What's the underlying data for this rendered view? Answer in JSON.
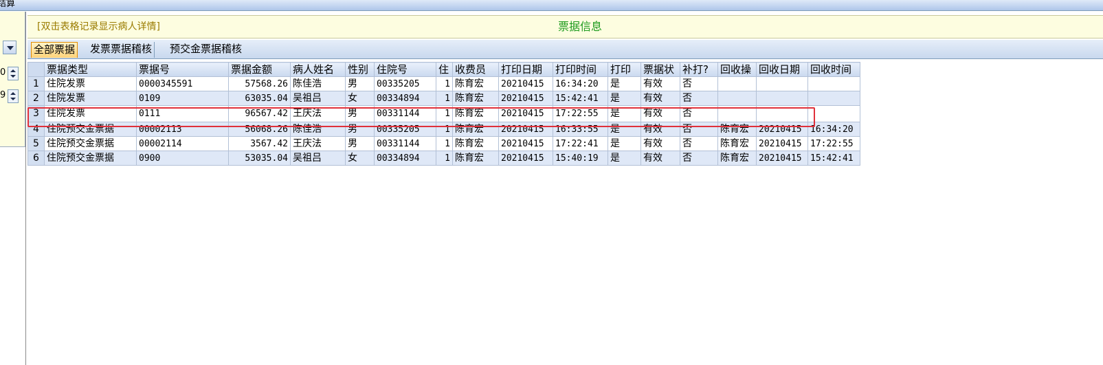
{
  "window": {
    "title_fragment": "结算"
  },
  "left_panel": {
    "spin1_value": "0",
    "spin2_value": "9"
  },
  "info_header": {
    "hint": "[双击表格记录显示病人详情]",
    "title": "票据信息"
  },
  "tabs": [
    {
      "label": "全部票据",
      "active": true
    },
    {
      "label": "发票票据稽核",
      "active": false
    },
    {
      "label": "预交金票据稽核",
      "active": false
    }
  ],
  "table": {
    "columns": [
      "票据类型",
      "票据号",
      "票据金额",
      "病人姓名",
      "性别",
      "住院号",
      "住",
      "收费员",
      "打印日期",
      "打印时间",
      "打印",
      "票据状",
      "补打?",
      "回收操",
      "回收日期",
      "回收时间"
    ],
    "rows": [
      [
        "1",
        "住院发票",
        "0000345591",
        "57568.26",
        "陈佳浩",
        "男",
        "00335205",
        "1",
        "陈育宏",
        "20210415",
        "16:34:20",
        "是",
        "有效",
        "否",
        "",
        "",
        ""
      ],
      [
        "2",
        "住院发票",
        "0109",
        "63035.04",
        "吴祖吕",
        "女",
        "00334894",
        "1",
        "陈育宏",
        "20210415",
        "15:42:41",
        "是",
        "有效",
        "否",
        "",
        "",
        ""
      ],
      [
        "3",
        "住院发票",
        "0111",
        "96567.42",
        "王庆法",
        "男",
        "00331144",
        "1",
        "陈育宏",
        "20210415",
        "17:22:55",
        "是",
        "有效",
        "否",
        "",
        "",
        ""
      ],
      [
        "4",
        "住院预交金票据",
        "00002113",
        "56068.26",
        "陈佳浩",
        "男",
        "00335205",
        "1",
        "陈育宏",
        "20210415",
        "16:33:55",
        "是",
        "有效",
        "否",
        "陈育宏",
        "20210415",
        "16:34:20"
      ],
      [
        "5",
        "住院预交金票据",
        "00002114",
        "3567.42",
        "王庆法",
        "男",
        "00331144",
        "1",
        "陈育宏",
        "20210415",
        "17:22:41",
        "是",
        "有效",
        "否",
        "陈育宏",
        "20210415",
        "17:22:55"
      ],
      [
        "6",
        "住院预交金票据",
        "0900",
        "53035.04",
        "吴祖吕",
        "女",
        "00334894",
        "1",
        "陈育宏",
        "20210415",
        "15:40:19",
        "是",
        "有效",
        "否",
        "陈育宏",
        "20210415",
        "15:42:41"
      ]
    ]
  },
  "colors": {
    "highlight": "#e0303a",
    "title_green": "#1b9a1b",
    "hint_text": "#9a7b00"
  }
}
